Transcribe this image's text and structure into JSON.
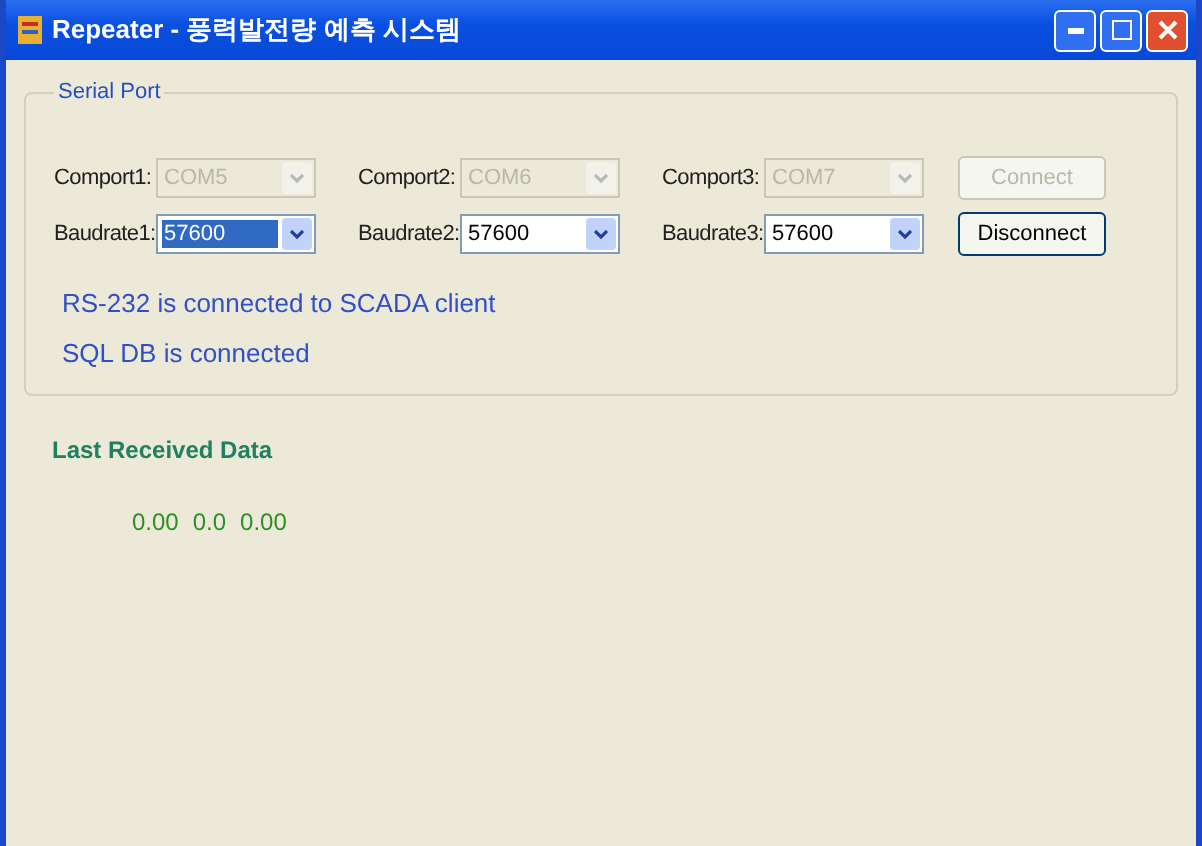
{
  "window": {
    "title": "Repeater - 풍력발전량 예측 시스템"
  },
  "serial_port": {
    "title": "Serial Port",
    "comports": [
      {
        "label": "Comport1:",
        "value": "COM5",
        "disabled": true
      },
      {
        "label": "Comport2:",
        "value": "COM6",
        "disabled": true
      },
      {
        "label": "Comport3:",
        "value": "COM7",
        "disabled": true
      }
    ],
    "baudrates": [
      {
        "label": "Baudrate1:",
        "value": "57600",
        "selected": true
      },
      {
        "label": "Baudrate2:",
        "value": "57600",
        "selected": false
      },
      {
        "label": "Baudrate3:",
        "value": "57600",
        "selected": false
      }
    ],
    "buttons": [
      {
        "label": "Connect",
        "disabled": true
      },
      {
        "label": "Disconnect",
        "disabled": false
      }
    ],
    "messages": [
      "RS-232 is connected to SCADA client",
      "SQL DB is connected"
    ]
  },
  "last_received": {
    "title": "Last Received Data",
    "values": [
      "0.00",
      "0.0",
      "0.00"
    ]
  }
}
